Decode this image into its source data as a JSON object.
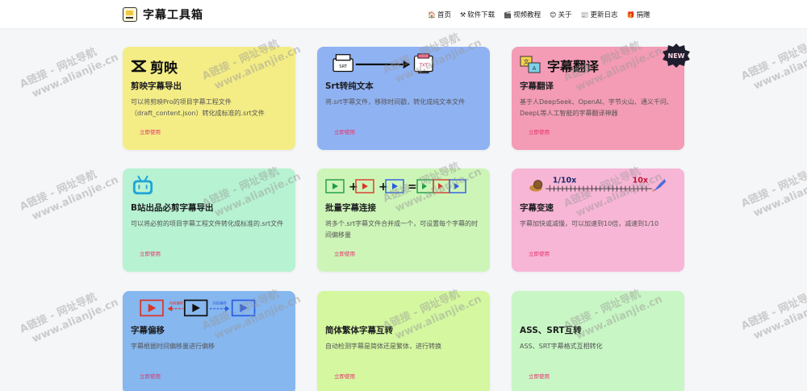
{
  "header": {
    "title": "字幕工具箱",
    "nav": [
      {
        "icon": "home-icon",
        "glyph": "🏠",
        "label": "首页"
      },
      {
        "icon": "tools-icon",
        "glyph": "⚒",
        "label": "软件下载"
      },
      {
        "icon": "video-icon",
        "glyph": "🎬",
        "label": "视频教程"
      },
      {
        "icon": "smile-icon",
        "glyph": "😊",
        "label": "关于"
      },
      {
        "icon": "news-icon",
        "glyph": "📰",
        "label": "更新日志"
      },
      {
        "icon": "gift-icon",
        "glyph": "🎁",
        "label": "捐赠"
      }
    ]
  },
  "cards": [
    {
      "title": "剪映字幕导出",
      "icon_text": "剪映",
      "desc": "可以将剪映Pro的项目字幕工程文件（draft_content.json）转化成标准的.srt文件",
      "button": "立即使用",
      "color": "#f4ed86"
    },
    {
      "title": "Srt转纯文本",
      "icon_text": "TXT",
      "icon_text2": "SRT",
      "desc": "将.srt字幕文件，移除时间戳，转化成纯文本文件",
      "button": "立即使用",
      "color": "#8fb2f3"
    },
    {
      "title": "字幕翻译",
      "icon_text": "字幕翻译",
      "badge": "NEW",
      "desc": "基于人DeepSeek、OpenAI、字节火山、通义千问、DeepL等人工智能的字幕翻译神器",
      "button": "立即使用",
      "color": "#f49bb5"
    },
    {
      "title": "B站出品必剪字幕导出",
      "desc": "可以将必剪的项目字幕工程文件转化成标准的.srt文件",
      "button": "立即使用",
      "color": "#b7f2d2"
    },
    {
      "title": "批量字幕连接",
      "desc": "将多个.srt字幕文件合并成一个，可设置每个字幕的时间偏移量",
      "button": "立即使用",
      "color": "#cdf5b7"
    },
    {
      "title": "字幕变速",
      "speed_min": "1/10x",
      "speed_max": "10x",
      "desc": "字幕加快或减慢，可以加速到10倍，减速到1/10",
      "button": "立即使用",
      "color": "#f8b6d6"
    },
    {
      "title": "字幕偏移",
      "shift_back": "向前偏移",
      "shift_fwd": "向后偏移",
      "desc": "字幕根据时间偏移量进行偏移",
      "button": "立即使用",
      "color": "#86b7ef"
    },
    {
      "title": "简体繁体字幕互转",
      "desc": "自动检测字幕是简体还是繁体，进行转换",
      "button": "立即使用",
      "color": "#d4f7a0"
    },
    {
      "title": "ASS、SRT互转",
      "desc": "ASS、SRT字幕格式互相转化",
      "button": "立即使用",
      "color": "#c8f6c4"
    }
  ],
  "watermark": {
    "line1": "A链接 - 网址导航",
    "line2": "www.alianjie.cn"
  }
}
